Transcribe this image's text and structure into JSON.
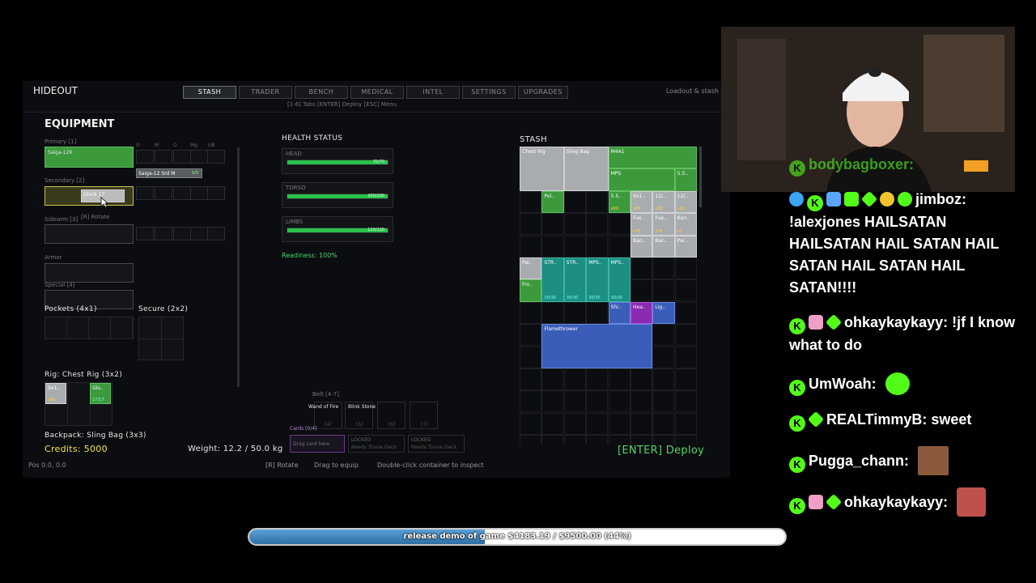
{
  "game": {
    "title": "HIDEOUT",
    "tabs": [
      "STASH",
      "TRADER",
      "BENCH",
      "MEDICAL",
      "INTEL",
      "SETTINGS",
      "UPGRADES"
    ],
    "active_tab": "STASH",
    "loadout_label": "Loadout & stash",
    "keys_hint": "[1-6] Tabs  [ENTER] Deploy  [ESC] Menu",
    "equipment": {
      "title": "EQUIPMENT",
      "primary_label": "Primary [1]",
      "primary_item": "Saiga-12K",
      "mod_headers": [
        "O",
        "M",
        "O",
        "Mg",
        "UB"
      ],
      "mag_item": "Saiga-12 Srd M",
      "mag_count": "5/5",
      "secondary_label": "Secondary [2]",
      "secondary_item": "Glock 17",
      "rotate_hint": "[R] Rotate",
      "sidearm_label": "Sidearm [3]",
      "armor_label": "Armor",
      "special_label": "Special [4]",
      "pockets_label": "Pockets (4x1)",
      "secure_label": "Secure (2x2)",
      "rig_label": "Rig: Chest Rig (3x2)",
      "rig_items": [
        {
          "name": "9x1..",
          "count": "x60"
        },
        {
          "name": "Glo..",
          "count": "17/17"
        }
      ],
      "backpack_label": "Backpack: Sling Bag (3x3)",
      "credits": "Credits: 5000",
      "pos": "Pos 0.0, 0.0"
    },
    "health": {
      "title": "HEALTH STATUS",
      "parts": [
        {
          "name": "HEAD",
          "value": "70/70",
          "fraction": 1.0
        },
        {
          "name": "TORSO",
          "value": "200/200",
          "fraction": 1.0
        },
        {
          "name": "LIMBS",
          "value": "120/120",
          "fraction": 1.0
        }
      ],
      "readiness": "Readiness: 100%"
    },
    "belt": {
      "label": "Belt [4-7]",
      "items": [
        "Wand of Fire",
        "Blink Stone"
      ],
      "keys": [
        "[4]",
        "[5]",
        "[6]",
        "[7]"
      ],
      "cards_label": "Cards [0/4]",
      "card_slots": [
        {
          "title": "Drag card here",
          "sub": ""
        },
        {
          "title": "LOCKED",
          "sub": "Needs Triune Deck"
        },
        {
          "title": "LOCKED",
          "sub": "Needs Triune Deck"
        }
      ]
    },
    "weight": "Weight: 12.2 / 50.0 kg",
    "hints": [
      "[R] Rotate",
      "Drag to equip",
      "Double-click container to inspect"
    ],
    "deploy": "[ENTER] Deploy",
    "stash": {
      "title": "STASH",
      "items": [
        {
          "name": "Chest Rig",
          "color": "grey",
          "count": ""
        },
        {
          "name": "Sling Bag",
          "color": "grey",
          "count": ""
        },
        {
          "name": "M4A1",
          "color": "green",
          "count": ""
        },
        {
          "name": "MPS",
          "color": "green",
          "count": ""
        },
        {
          "name": "5.5..",
          "color": "green",
          "count": "x60"
        },
        {
          "name": "Pol..",
          "color": "green",
          "count": ""
        },
        {
          "name": "5.5..",
          "color": "green",
          "count": "x60"
        },
        {
          "name": "9x1..",
          "color": "grey",
          "count": "x60"
        },
        {
          "name": "12/..",
          "color": "grey",
          "count": "x20"
        },
        {
          "name": "12/..",
          "color": "grey",
          "count": "x20"
        },
        {
          "name": "Fue..",
          "color": "grey",
          "count": "x75"
        },
        {
          "name": "Fue..",
          "color": "grey",
          "count": "x75"
        },
        {
          "name": "Ban..",
          "color": "grey",
          "count": "x3"
        },
        {
          "name": "Ban..",
          "color": "grey",
          "count": ""
        },
        {
          "name": "Ban..",
          "color": "grey",
          "count": ""
        },
        {
          "name": "Pai..",
          "color": "grey",
          "count": ""
        },
        {
          "name": "Pai..",
          "color": "grey",
          "count": ""
        },
        {
          "name": "STR..",
          "color": "teal",
          "count": "30/30"
        },
        {
          "name": "STR..",
          "color": "teal",
          "count": "30/30"
        },
        {
          "name": "MPS..",
          "color": "teal",
          "count": "30/30"
        },
        {
          "name": "MPS..",
          "color": "teal",
          "count": "30/30"
        },
        {
          "name": "Fro..",
          "color": "green",
          "count": ""
        },
        {
          "name": "Shi..",
          "color": "blue",
          "count": ""
        },
        {
          "name": "Hea..",
          "color": "purple",
          "count": ""
        },
        {
          "name": "Lig..",
          "color": "blue",
          "count": ""
        },
        {
          "name": "Flamethrower",
          "color": "blue",
          "count": ""
        }
      ]
    }
  },
  "chat": {
    "cut_line": "bodybagboxer:",
    "messages": [
      {
        "user": "jimboz:",
        "text": "!alexjones HAILSATAN HAILSATAN HAIL SATAN HAIL SATAN HAIL SATAN HAIL SATAN!!!!"
      },
      {
        "user": "ohkaykaykayy:",
        "text": "!jf I know what to do"
      },
      {
        "user": "UmWoah:",
        "text": ""
      },
      {
        "user": "REALTimmyB:",
        "text": "sweet"
      },
      {
        "user": "Pugga_chann:",
        "text": ""
      },
      {
        "user": "ohkaykaykayy:",
        "text": ""
      }
    ],
    "colors": {
      "kick_green": "#53fc18"
    }
  },
  "donation_goal": {
    "text": "release demo of game $4183.19 / $9500.00 (44%)",
    "fraction": 0.44
  }
}
